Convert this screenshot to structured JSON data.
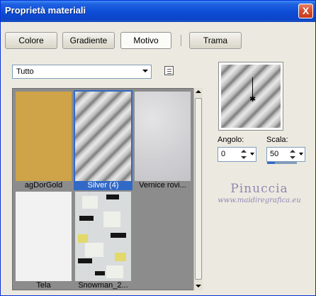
{
  "window": {
    "title": "Proprietà materiali",
    "close_label": "X"
  },
  "tabs": [
    {
      "label": "Colore",
      "active": false
    },
    {
      "label": "Gradiente",
      "active": false
    },
    {
      "label": "Motivo",
      "active": true
    },
    {
      "label": "Trama",
      "active": false
    }
  ],
  "category": {
    "value": "Tutto"
  },
  "patterns": [
    {
      "label": "agDorGold",
      "selected": false
    },
    {
      "label": "Silver (4)",
      "selected": true
    },
    {
      "label": "Vernice rovi...",
      "selected": false
    },
    {
      "label": "Tela",
      "selected": false
    },
    {
      "label": "Snowman_2...",
      "selected": false
    }
  ],
  "angle": {
    "label": "Angolo:",
    "value": "0"
  },
  "scale": {
    "label": "Scala:",
    "value": "50",
    "fraction": 0.25
  },
  "watermark": {
    "name": "Pinuccia",
    "url": "www.maidiregrafica.eu"
  },
  "colors": {
    "accent": "#3169c6",
    "gold": "#cfa347",
    "titlebar": "#0f4fd8"
  }
}
